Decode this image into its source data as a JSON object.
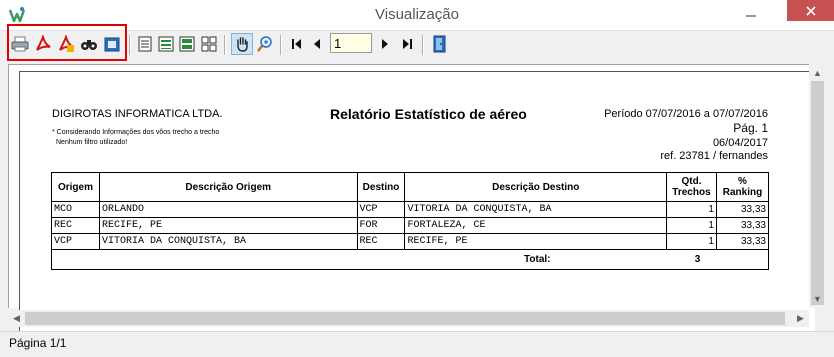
{
  "window": {
    "title": "Visualização"
  },
  "toolbar": {
    "page_value": "1",
    "buttons": [
      {
        "name": "print-icon"
      },
      {
        "name": "pdf-icon"
      },
      {
        "name": "pdf-export-icon"
      },
      {
        "name": "find-icon"
      },
      {
        "name": "export-icon"
      },
      {
        "name": "view-one-page-icon"
      },
      {
        "name": "view-page-width-icon"
      },
      {
        "name": "view-two-pages-icon"
      },
      {
        "name": "view-four-pages-icon"
      },
      {
        "name": "hand-tool-icon"
      },
      {
        "name": "zoom-icon"
      },
      {
        "name": "first-page-icon"
      },
      {
        "name": "prev-page-icon"
      },
      {
        "name": "next-page-icon"
      },
      {
        "name": "last-page-icon"
      },
      {
        "name": "exit-icon"
      }
    ]
  },
  "report": {
    "company": "DIGIROTAS INFORMATICA LTDA.",
    "title": "Relatório Estatístico de aéreo",
    "period": "Período 07/07/2016 a 07/07/2016",
    "page": "Pág. 1",
    "date": "06/04/2017",
    "ref": "ref. 23781 / fernandes",
    "note1": "* Considerando Informações dos vôos trecho a trecho",
    "note2": "Nenhum filtro utilizado!",
    "headers": {
      "origem": "Origem",
      "desc_origem": "Descrição Origem",
      "destino": "Destino",
      "desc_destino": "Descrição Destino",
      "qtd1": "Qtd.",
      "qtd2": "Trechos",
      "rank1": "%",
      "rank2": "Ranking"
    },
    "rows": [
      {
        "origem": "MCO",
        "desc_origem": "ORLANDO",
        "destino": "VCP",
        "desc_destino": "VITORIA DA CONQUISTA, BA",
        "qtd": "1",
        "ranking": "33,33"
      },
      {
        "origem": "REC",
        "desc_origem": "RECIFE, PE",
        "destino": "FOR",
        "desc_destino": "FORTALEZA, CE",
        "qtd": "1",
        "ranking": "33,33"
      },
      {
        "origem": "VCP",
        "desc_origem": "VITORIA DA CONQUISTA, BA",
        "destino": "REC",
        "desc_destino": "RECIFE, PE",
        "qtd": "1",
        "ranking": "33,33"
      }
    ],
    "total_label": "Total:",
    "total_value": "3"
  },
  "status": {
    "text": "Página 1/1"
  }
}
